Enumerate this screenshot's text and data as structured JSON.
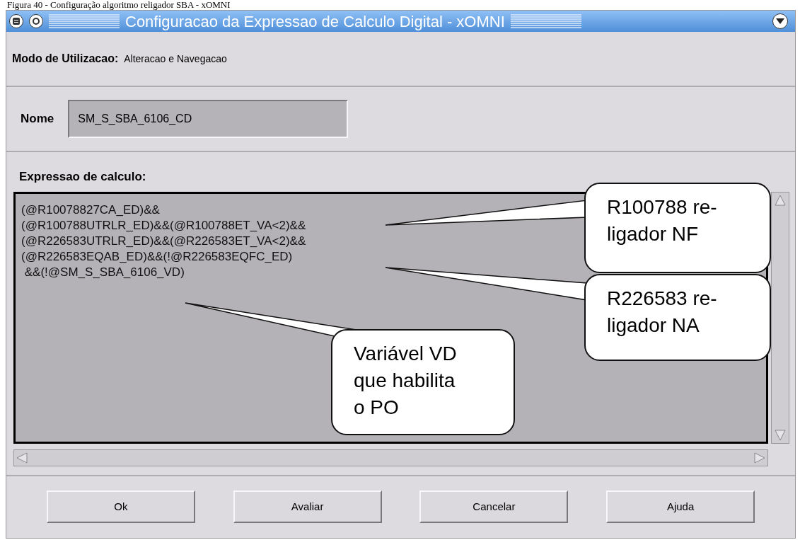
{
  "caption": "Figura 40 - Configuração algoritmo religador SBA - xOMNI",
  "window": {
    "title": "Configuracao da Expressao de Calculo Digital - xOMNI"
  },
  "mode": {
    "label": "Modo de Utilizacao:",
    "value": "Alteracao e Navegacao"
  },
  "name_field": {
    "label": "Nome",
    "value": "SM_S_SBA_6106_CD"
  },
  "expression": {
    "label": "Expressao de calculo:",
    "lines": [
      "(@R10078827CA_ED)&&",
      "(@R100788UTRLR_ED)&&(@R100788ET_VA<2)&&",
      "(@R226583UTRLR_ED)&&(@R226583ET_VA<2)&&",
      "(@R226583EQAB_ED)&&(!@R226583EQFC_ED)",
      " &&(!@SM_S_SBA_6106_VD)"
    ]
  },
  "callouts": [
    {
      "lines": [
        "R100788 re-",
        "ligador NF"
      ]
    },
    {
      "lines": [
        "R226583 re-",
        "ligador NA"
      ]
    },
    {
      "lines": [
        "Variável VD",
        "que habilita",
        "o PO"
      ]
    }
  ],
  "buttons": [
    "Ok",
    "Avaliar",
    "Cancelar",
    "Ajuda"
  ]
}
